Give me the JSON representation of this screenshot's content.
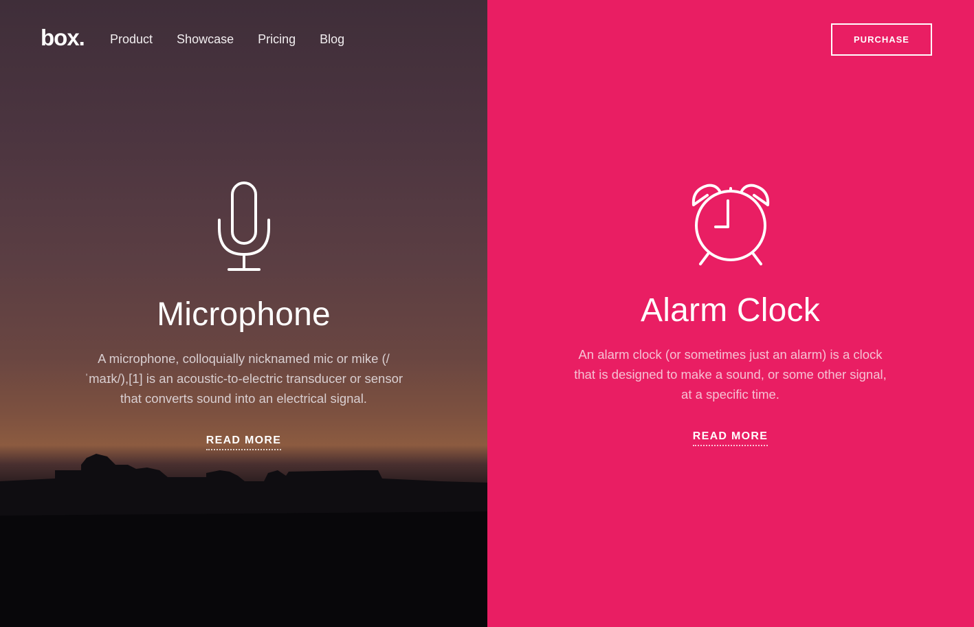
{
  "header": {
    "logo": "box.",
    "nav": [
      "Product",
      "Showcase",
      "Pricing",
      "Blog"
    ],
    "purchase_label": "PURCHASE"
  },
  "features": [
    {
      "icon": "microphone-icon",
      "title": "Microphone",
      "description": "A microphone, colloquially nicknamed mic or mike (/ˈmaɪk/),[1] is an acoustic-to-electric transducer or sensor that converts sound into an electrical signal.",
      "link": "READ MORE"
    },
    {
      "icon": "alarm-clock-icon",
      "title": "Alarm Clock",
      "description": "An alarm clock (or sometimes just an alarm) is a clock that is designed to make a sound, or some other signal, at a specific time.",
      "link": "READ MORE"
    }
  ],
  "colors": {
    "accent": "#e91e63",
    "left_background_top": "#3f2e39",
    "left_background_bottom": "#0a090c"
  }
}
